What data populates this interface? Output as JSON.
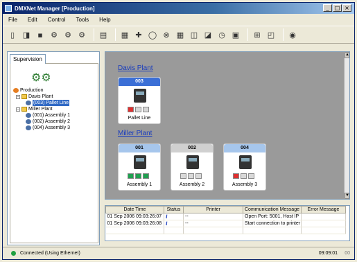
{
  "window": {
    "title": "DMXNet Manager [Production]",
    "buttons": {
      "minimize": "_",
      "maximize": "□",
      "close": "×"
    }
  },
  "menu": [
    "File",
    "Edit",
    "Control",
    "Tools",
    "Help"
  ],
  "supervision": {
    "tab_label": "Supervision",
    "tree": [
      {
        "label": "Production",
        "level": 0,
        "icon": "production-icon"
      },
      {
        "label": "Davis Plant",
        "level": 1,
        "icon": "folder-icon"
      },
      {
        "label": "(003) Pallet Line",
        "level": 2,
        "icon": "device-icon",
        "selected": true
      },
      {
        "label": "Miller Plant",
        "level": 1,
        "icon": "folder-icon"
      },
      {
        "label": "(001) Assembly 1",
        "level": 2,
        "icon": "device-icon"
      },
      {
        "label": "(002) Assembly 2",
        "level": 2,
        "icon": "device-icon"
      },
      {
        "label": "(004) Assembly 3",
        "level": 2,
        "icon": "device-icon"
      }
    ]
  },
  "canvas": {
    "plants": [
      {
        "name": "Davis Plant",
        "devices": [
          {
            "id": "003",
            "label": "Pallet Line",
            "header": "blue",
            "leds": [
              "red",
              "grey",
              "grey"
            ]
          }
        ]
      },
      {
        "name": "Miller Plant",
        "devices": [
          {
            "id": "001",
            "label": "Assembly 1",
            "header": "light",
            "leds": [
              "green",
              "green",
              "green"
            ]
          },
          {
            "id": "002",
            "label": "Assembly 2",
            "header": "grey",
            "leds": [
              "grey",
              "grey",
              "grey"
            ]
          },
          {
            "id": "004",
            "label": "Assembly 3",
            "header": "light",
            "leds": [
              "red",
              "grey",
              "grey"
            ]
          }
        ]
      }
    ]
  },
  "log": {
    "columns": [
      "Date Time",
      "Status",
      "Printer",
      "Communication Message",
      "Error Message"
    ],
    "rows": [
      {
        "datetime": "01 Sep 2006 09:03:26:07",
        "status_icon": "info-icon",
        "printer": "--",
        "comm": "Open Port: 5001, Host IP",
        "error": ""
      },
      {
        "datetime": "01 Sep 2006 09:03:26:08",
        "status_icon": "info-icon",
        "printer": "--",
        "comm": "Start connection to printer",
        "error": ""
      }
    ]
  },
  "statusbar": {
    "connection": "Connected (Using Ethernet)",
    "time": "09:09:01",
    "indicator": "00"
  }
}
